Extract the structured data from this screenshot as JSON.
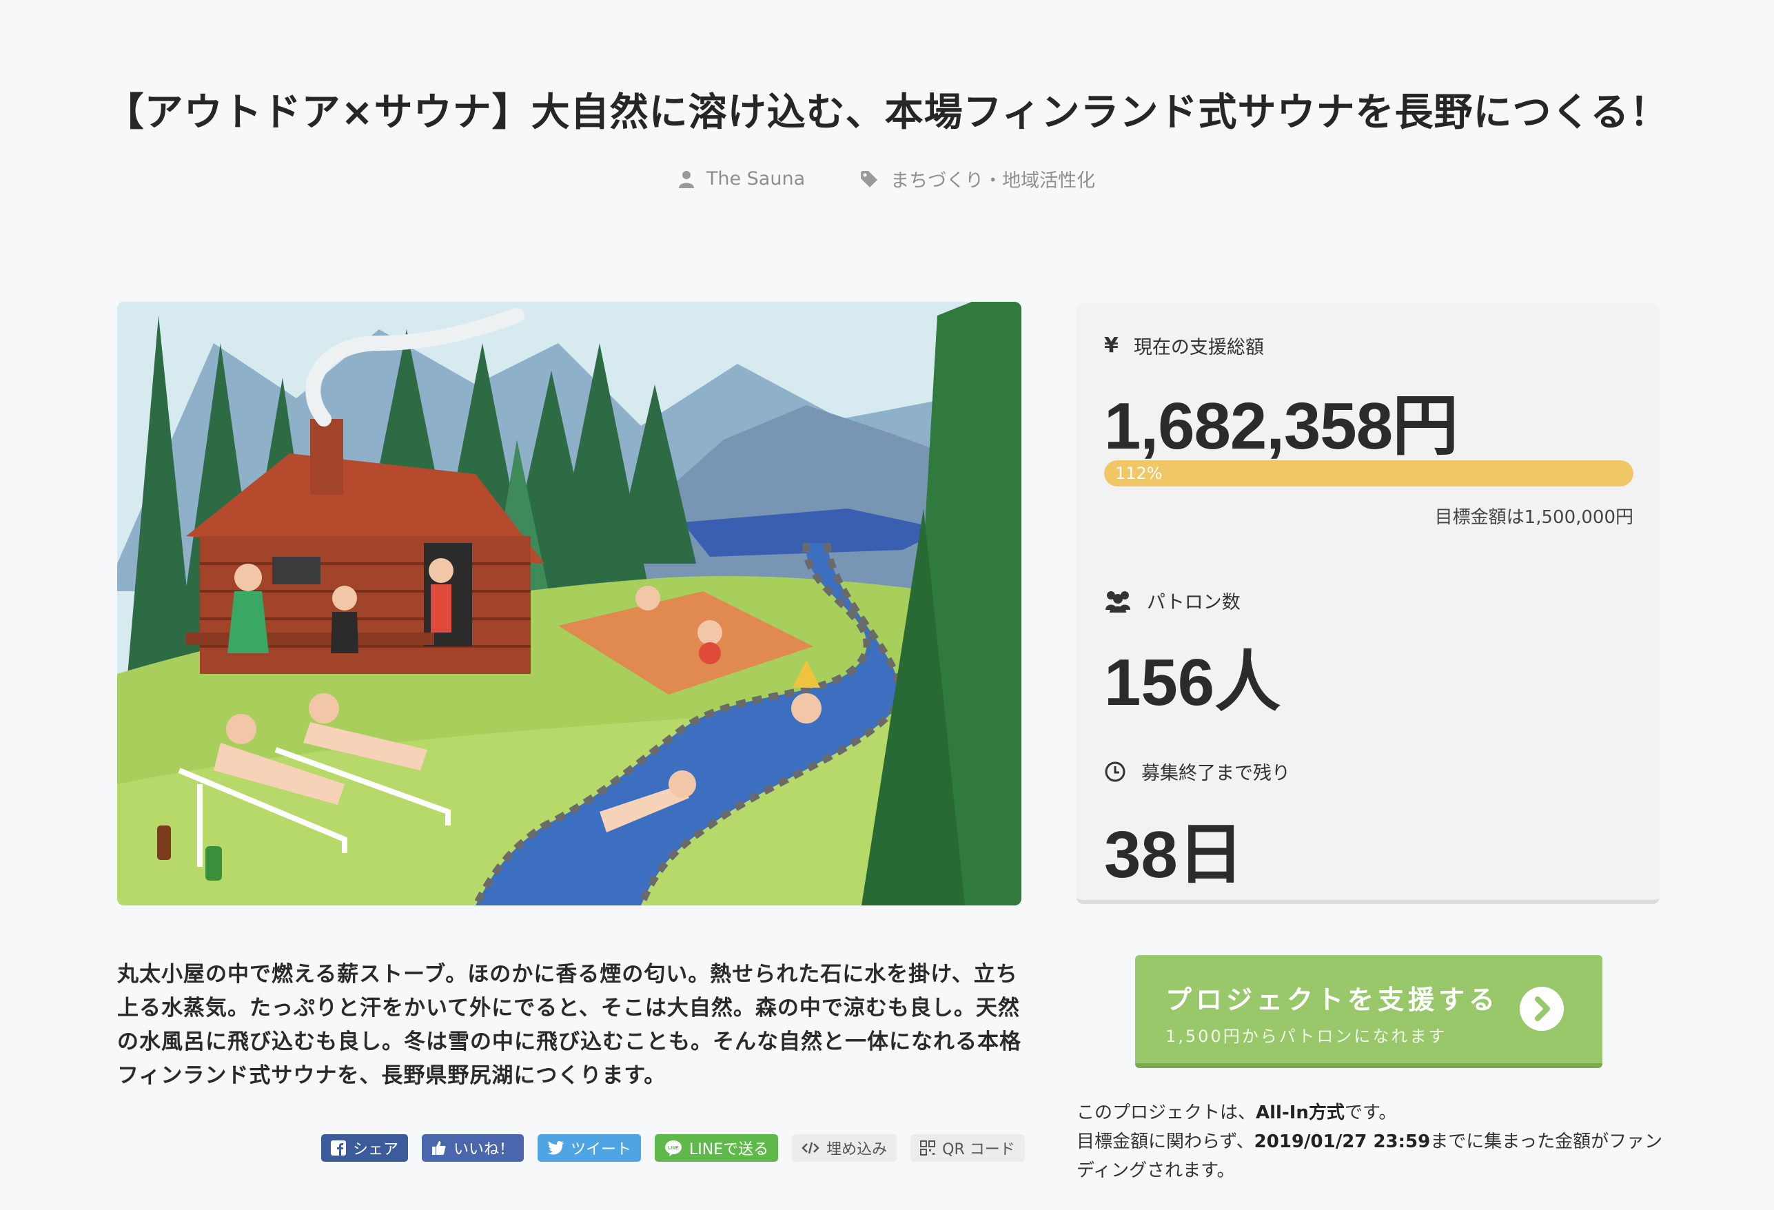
{
  "project": {
    "title": "【アウトドア×サウナ】大自然に溶け込む、本場フィンランド式サウナを長野につくる！",
    "owner": "The Sauna",
    "category": "まちづくり・地域活性化"
  },
  "stats": {
    "amount_label": "現在の支援総額",
    "amount": "1,682,358円",
    "progress_label": "112%",
    "progress_fraction": 1.0,
    "goal_text": "目標金額は1,500,000円",
    "patrons_label": "パトロン数",
    "patrons": "156人",
    "remaining_label": "募集終了まで残り",
    "remaining": "38日"
  },
  "description": "丸太小屋の中で燃える薪ストーブ。ほのかに香る煙の匂い。熱せられた石に水を掛け、立ち上る水蒸気。たっぷりと汗をかいて外にでると、そこは大自然。森の中で涼むも良し。天然の水風呂に飛び込むも良し。冬は雪の中に飛び込むことも。そんな自然と一体になれる本格フィンランド式サウナを、長野県野尻湖につくります。",
  "share": {
    "facebook": "シェア",
    "like": "いいね！",
    "tweet": "ツイート",
    "line": "LINEで送る",
    "embed": "埋め込み",
    "qr": "QR コード"
  },
  "support": {
    "button_title": "プロジェクトを支援する",
    "button_sub": "1,500円からパトロンになれます",
    "note_line1_prefix": "このプロジェクトは、",
    "note_line1_bold": "All-In方式",
    "note_line1_suffix": "です。",
    "note_line2_prefix": "目標金額に関わらず、",
    "note_line2_bold": "2019/01/27 23:59",
    "note_line2_suffix": "までに集まった金額がファンディングされます。"
  },
  "colors": {
    "progress": "#f1c766",
    "support_button": "#98c86a",
    "facebook": "#3b5b9a",
    "twitter": "#4fa4e3",
    "line": "#5fb94a"
  }
}
